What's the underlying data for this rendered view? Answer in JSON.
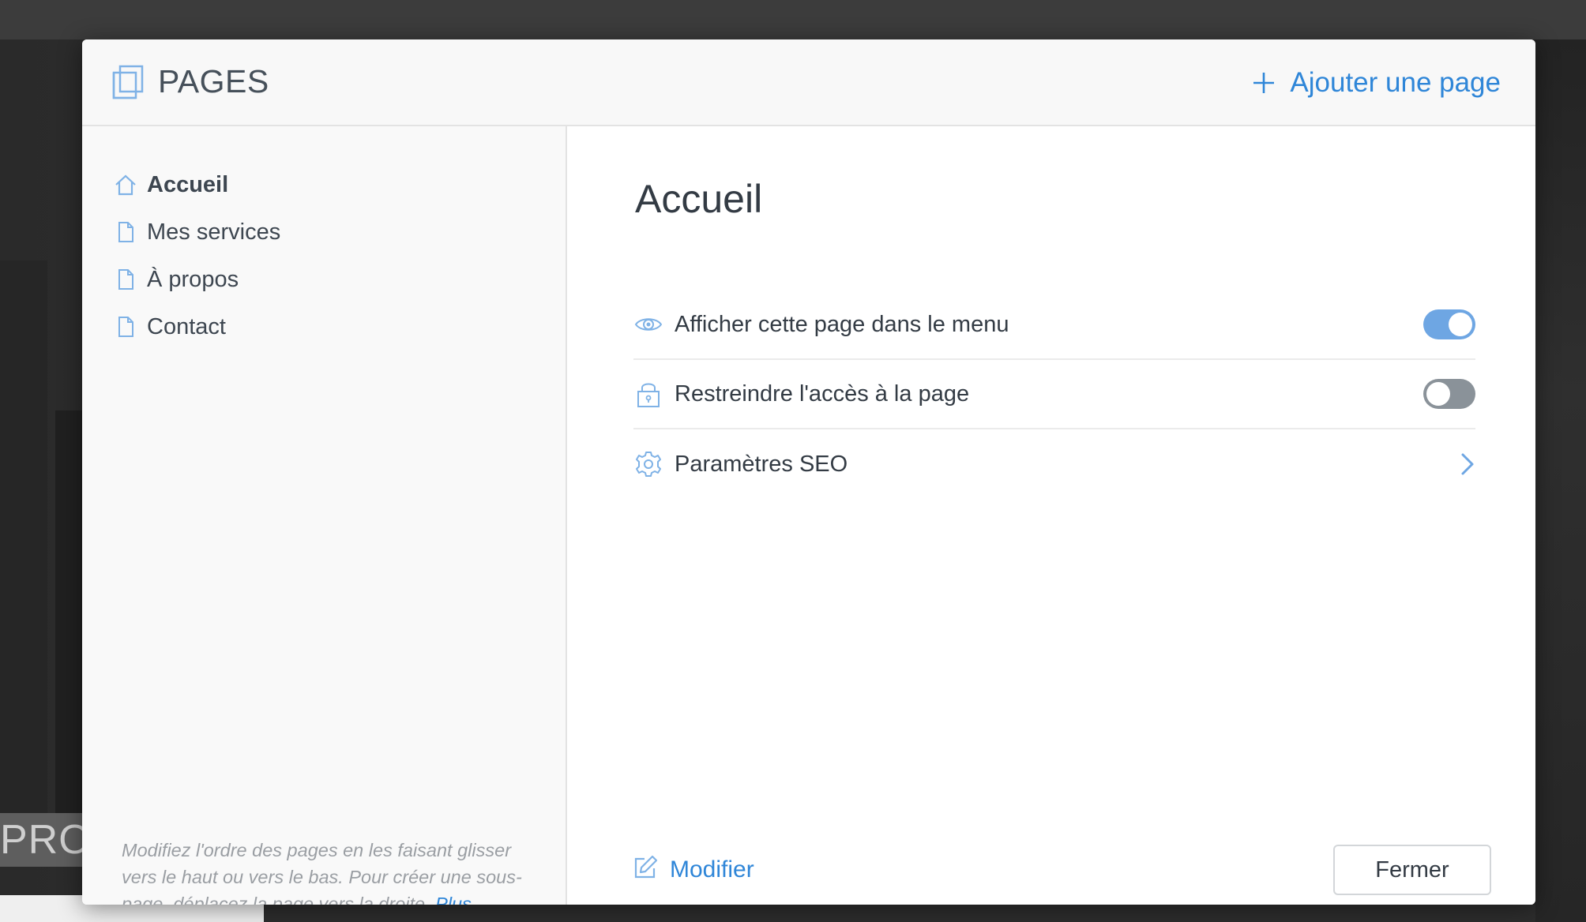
{
  "header": {
    "title": "PAGES",
    "add_page_label": "Ajouter une page"
  },
  "sidebar": {
    "items": [
      {
        "label": "Accueil",
        "icon": "home-icon",
        "active": true
      },
      {
        "label": "Mes services",
        "icon": "page-icon",
        "active": false
      },
      {
        "label": "À propos",
        "icon": "page-icon",
        "active": false
      },
      {
        "label": "Contact",
        "icon": "page-icon",
        "active": false
      }
    ],
    "help_text": "Modifiez l'ordre des pages en les faisant glisser vers le haut ou vers le bas. Pour créer une sous-page, déplacez la page vers la droite.",
    "help_link": "Plus d'informations",
    "help_suffix": "."
  },
  "main": {
    "title": "Accueil",
    "settings": [
      {
        "label": "Afficher cette page dans le menu",
        "icon": "eye-icon",
        "control": "toggle",
        "value": true
      },
      {
        "label": "Restreindre l'accès à la page",
        "icon": "lock-icon",
        "control": "toggle",
        "value": false
      },
      {
        "label": "Paramètres SEO",
        "icon": "gear-icon",
        "control": "chevron"
      }
    ],
    "modify_label": "Modifier",
    "close_label": "Fermer"
  },
  "background": {
    "partial_text": "PROF"
  },
  "colors": {
    "accent": "#2f86d8",
    "toggle_on": "#6ea6e3",
    "toggle_off": "#8a9299",
    "text": "#333b44",
    "muted": "#9a9ea3"
  }
}
